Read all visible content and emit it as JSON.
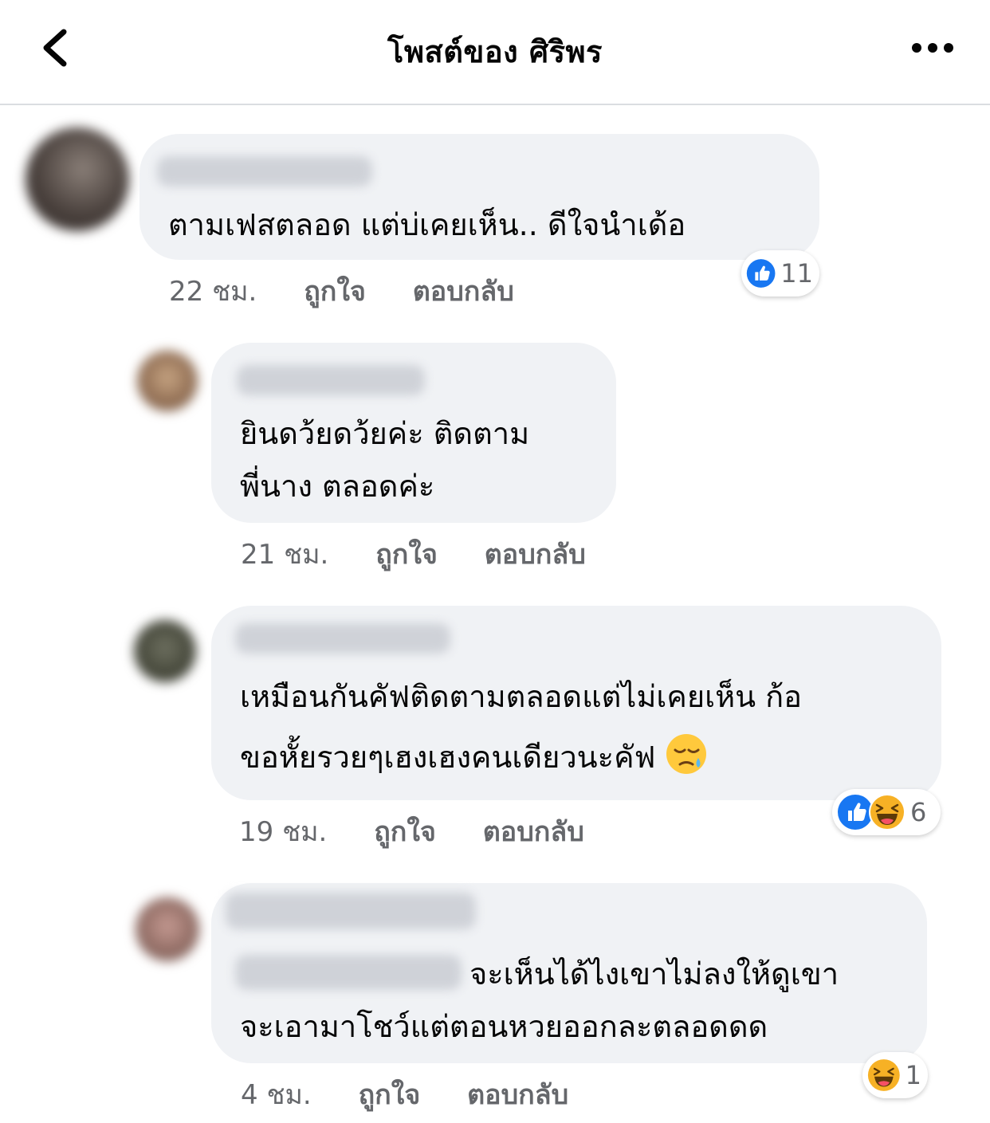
{
  "header": {
    "title": "โพสต์ของ ศิริพร",
    "back_icon": "chevron-left-icon",
    "more_icon": "more-horizontal-icon"
  },
  "comments": [
    {
      "text_lines": [
        "ตามเฟสตลอด แต่บ่เคยเห็น.. ดีใจนำเด้อ"
      ],
      "time": "22 ชม.",
      "like_label": "ถูกใจ",
      "reply_label": "ตอบกลับ",
      "reactions": [
        "like-icon"
      ],
      "reaction_count": "11"
    },
    {
      "text_lines": [
        "ยินดว้ยดว้ยค่ะ ติดตาม",
        "พี่นาง ตลอดค่ะ"
      ],
      "time": "21 ชม.",
      "like_label": "ถูกใจ",
      "reply_label": "ตอบกลับ"
    },
    {
      "text_lines": [
        "เหมือนกันคัฟติดตามตลอดแต่ไม่เคยเห็น ก้อ",
        "ขอหั้ยรวยๆเฮงเฮงคนเดียวนะคัฟ"
      ],
      "emoji": "sleepy-face-icon",
      "time": "19 ชม.",
      "like_label": "ถูกใจ",
      "reply_label": "ตอบกลับ",
      "reactions": [
        "like-icon",
        "haha-icon"
      ],
      "reaction_count": "6"
    },
    {
      "text_lines": [
        "จะเห็นได้ไงเขาไม่ลงให้ดูเขา",
        "จะเอามาโชว์แต่ตอนหวยออกละตลอดดด"
      ],
      "time": "4 ชม.",
      "like_label": "ถูกใจ",
      "reply_label": "ตอบกลับ",
      "reactions": [
        "haha-icon"
      ],
      "reaction_count": "1"
    }
  ]
}
